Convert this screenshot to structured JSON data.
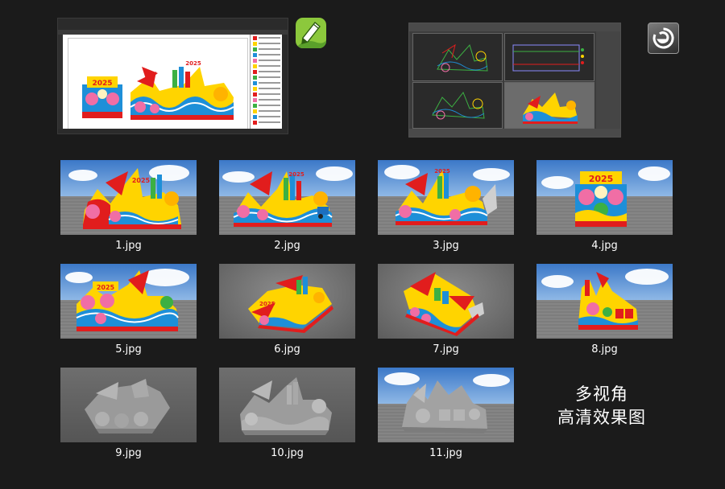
{
  "software": {
    "coreldraw": {
      "logo_icon": "coreldraw-logo-icon",
      "accent": "#8cc83c"
    },
    "max3ds": {
      "logo_icon": "3ds-max-logo-icon",
      "accent": "#5a5a5a"
    }
  },
  "thumbnails": [
    {
      "caption": "1.jpg"
    },
    {
      "caption": "2.jpg"
    },
    {
      "caption": "3.jpg"
    },
    {
      "caption": "4.jpg"
    },
    {
      "caption": "5.jpg"
    },
    {
      "caption": "6.jpg"
    },
    {
      "caption": "7.jpg"
    },
    {
      "caption": "8.jpg"
    },
    {
      "caption": "9.jpg"
    },
    {
      "caption": "10.jpg"
    },
    {
      "caption": "11.jpg"
    }
  ],
  "headline": {
    "line1": "多视角",
    "line2": "高清效果图"
  },
  "design_text": {
    "year": "2025"
  },
  "colors": {
    "background": "#1b1b1b",
    "red": "#e11d1d",
    "yellow": "#ffd400",
    "blue": "#1e8fd8",
    "green": "#3cb043",
    "pink": "#f06ea5"
  }
}
